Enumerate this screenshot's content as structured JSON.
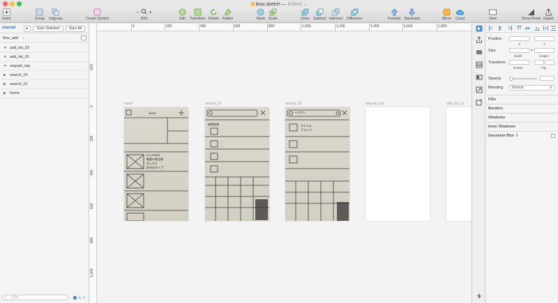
{
  "window": {
    "title": "ikou.sketch",
    "status": "Edited"
  },
  "toolbar": {
    "insert": "Insert",
    "group": "Group",
    "ungroup": "Ungroup",
    "create_symbol": "Create Symbol",
    "zoom": "50%",
    "zoom_minus": "−",
    "zoom_plus": "+",
    "edit": "Edit",
    "transform": "Transform",
    "rotate": "Rotate",
    "flatten": "Flatten",
    "mask": "Mask",
    "scale": "Scale",
    "union": "Union",
    "subtract": "Subtract",
    "intersect": "Intersect",
    "difference": "Difference",
    "forward": "Forward",
    "backward": "Backward",
    "mirror": "Mirror",
    "cloud": "Cloud",
    "view": "View",
    "show_pixels": "Show Pixels",
    "export": "Export"
  },
  "sidebar": {
    "plugin_logo": "marvel",
    "sync_selected": "Sync Selected",
    "sync_all": "Sync All",
    "page_selector": "flow_add",
    "layers": [
      {
        "name": "add_list_02",
        "expanded": true
      },
      {
        "name": "add_list_01",
        "expanded": true
      },
      {
        "name": "ungrain_top",
        "expanded": true
      },
      {
        "name": "search_02",
        "expanded": false
      },
      {
        "name": "search_01",
        "expanded": false
      },
      {
        "name": "home",
        "expanded": false
      }
    ],
    "filter_placeholder": "Filter",
    "filter_count": "6"
  },
  "canvas": {
    "ruler_top": [
      "0",
      "200",
      "400",
      "600",
      "800",
      "1,000",
      "1,200",
      "1,400",
      "1,600",
      "1,800"
    ],
    "ruler_left": [
      "-200",
      "0",
      "200",
      "400",
      "600",
      "800",
      "1,000"
    ],
    "artboards": [
      {
        "name": "home",
        "sketch_text": {
          "title": "ikou",
          "item": "UV GRAIN",
          "note1": "軽量の高品質",
          "note2": "ゆったり",
          "note3": "好みのタイプ"
        }
      },
      {
        "name": "search_01",
        "sketch_text": {
          "label": "検索結果"
        }
      },
      {
        "name": "search_02",
        "sketch_text": {
          "query": "イヤホン",
          "label1": "アイテム",
          "label2": "ブランド"
        }
      },
      {
        "name": "ungrain_top"
      },
      {
        "name": "add_list_01"
      }
    ]
  },
  "inspector": {
    "position": "Position",
    "x": "X",
    "y": "Y",
    "size": "Size",
    "width": "Width",
    "height": "Height",
    "transform": "Transform",
    "rotate": "Rotate",
    "flip": "Flip",
    "opacity": "Opacity",
    "blending": "Blending",
    "blending_value": "Normal",
    "fills": "Fills",
    "borders": "Borders",
    "shadows": "Shadows",
    "inner_shadows": "Inner Shadows",
    "gaussian_blur": "Gaussian Blur"
  },
  "colors": {
    "accent": "#4a90d9",
    "close": "#fc605c",
    "minimize": "#fdbc40",
    "zoom": "#34c84a"
  }
}
